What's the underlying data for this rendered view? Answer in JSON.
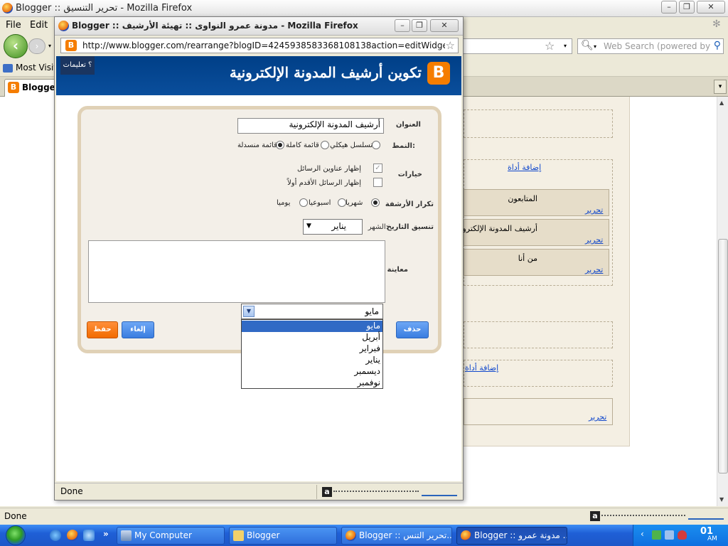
{
  "main_window": {
    "title": "Blogger :: تحرير التنسيق - Mozilla Firefox",
    "menu": [
      "File",
      "Edit"
    ],
    "search_placeholder": "Web Search (powered by Go",
    "bookmarks_label": "Most Visit",
    "tab_label": "Blogger",
    "status": "Done"
  },
  "layout_page": {
    "add_gadget": "إضافة أداة",
    "edit_link": "تحرير",
    "widgets": [
      {
        "name": "المتابعون",
        "edit": "تحرير"
      },
      {
        "name": "أرشيف المدونة الإلكترونية",
        "edit": "تحرير"
      },
      {
        "name": "من أنا",
        "edit": "تحرير"
      }
    ]
  },
  "popup": {
    "title": "Blogger :: مدونة عمرو النواوى :: تهيئة الأرشيف - Mozilla Firefox",
    "url": "http://www.blogger.com/rearrange?blogID=4245938583368108138action=editWidget&section",
    "status": "Done"
  },
  "blog_header": {
    "title": "تكوين أرشيف المدونة الإلكترونية",
    "logo_letter": "B",
    "help_text": "؟ تعليمات"
  },
  "form": {
    "title_label": "العنوان",
    "title_value": "أرشيف المدونة الإلكترونية",
    "style_label": "النمط:",
    "style_options": [
      "تسلسل هيكلي",
      "قائمة كاملة",
      "قائمة منسدلة"
    ],
    "style_selected": "قائمة منسدلة",
    "options_label": "خيارات",
    "option_show_titles": "إظهار عناوين الرسائل",
    "option_show_oldest": "إظهار الرسائل الأقدم أولاً",
    "frequency_label": "تكرار الأرشفة",
    "frequency_options": [
      "شهريا",
      "اسبوعيا",
      "يوميا"
    ],
    "frequency_selected": "شهريا",
    "date_format_label": "تنسيق التاريخ",
    "month_label": "الشهر:",
    "month_value": "يناير",
    "preview_label": "معاينة",
    "save_button": "حفظ",
    "cancel_button": "إلغاء",
    "delete_button": "حذف"
  },
  "preview_dropdown": {
    "value": "مايو",
    "items": [
      "مايو",
      "أبريل",
      "فبراير",
      "يناير",
      "ديسمبر",
      "نوفمبر"
    ],
    "highlighted": "مايو"
  },
  "taskbar": {
    "buttons": [
      {
        "label": "My Computer"
      },
      {
        "label": "Blogger"
      },
      {
        "label": "Blogger :: تحرير التنس..."
      },
      {
        "label": "Blogger :: مدونة عمرو ..."
      }
    ],
    "clock": "01",
    "ampm": "AM",
    "overflow": "»"
  },
  "colors": {
    "blogger_orange": "#f57d00",
    "header_blue": "#003f87",
    "button_blue": "#3a7de0",
    "selection_blue": "#316ac5",
    "link_blue": "#1148cc"
  }
}
